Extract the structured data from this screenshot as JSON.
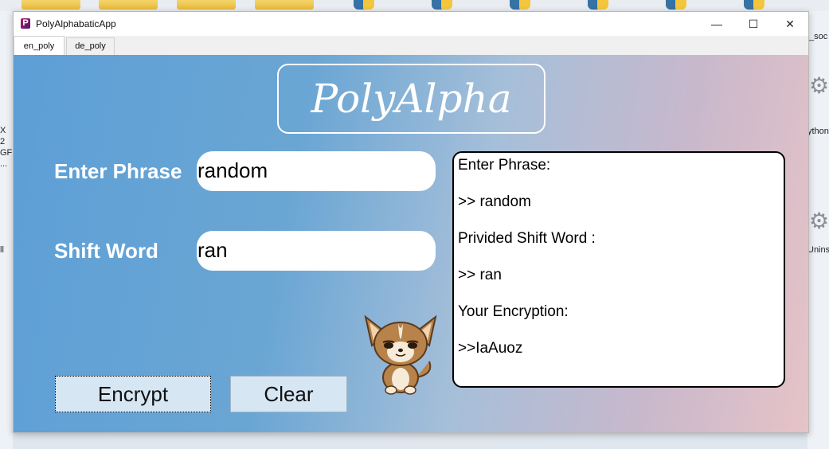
{
  "desktop": {
    "right_labels": [
      "_soc",
      "ython",
      "Unins"
    ],
    "left_labels": [
      "X",
      "2",
      "GF",
      "...",
      "ll"
    ]
  },
  "window": {
    "title": "PolyAlphabaticApp",
    "controls": {
      "minimize": "—",
      "maximize": "☐",
      "close": "✕"
    }
  },
  "tabs": [
    {
      "label": "en_poly",
      "active": true
    },
    {
      "label": "de_poly",
      "active": false
    }
  ],
  "app": {
    "logo": "PolyAlpha",
    "phrase_label": "Enter Phrase",
    "phrase_value": "random",
    "shift_label": "Shift Word",
    "shift_value": "ran",
    "output_lines": [
      "Enter Phrase:",
      ">> random",
      "Privided Shift Word :",
      ">> ran",
      "Your Encryption:",
      ">>IaAuoz"
    ],
    "encrypt_label": "Encrypt",
    "clear_label": "Clear"
  },
  "colors": {
    "gradient_left": "#5d9fd6",
    "gradient_right": "#e6c3c7",
    "button_bg": "#d6e6f3"
  },
  "icons": {
    "app": "app-logo-icon",
    "mascot": "chihuahua-mascot-icon"
  }
}
